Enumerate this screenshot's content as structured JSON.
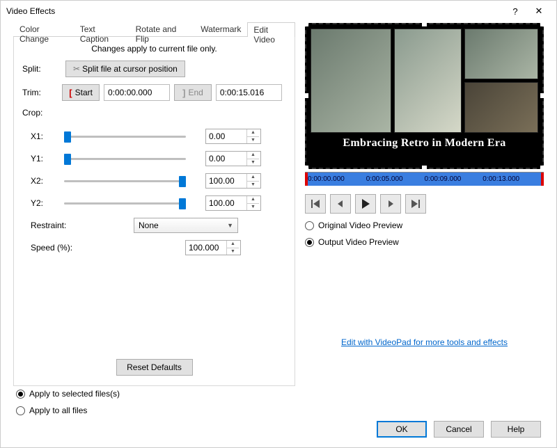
{
  "title": "Video Effects",
  "tabs": [
    "Color Change",
    "Text Caption",
    "Rotate and Flip",
    "Watermark",
    "Edit Video"
  ],
  "activeTab": 4,
  "note": "Changes apply to current file only.",
  "labels": {
    "split": "Split:",
    "split_btn": "Split file at cursor position",
    "trim": "Trim:",
    "start": "Start",
    "end": "End",
    "crop": "Crop:",
    "x1": "X1:",
    "y1": "Y1:",
    "x2": "X2:",
    "y2": "Y2:",
    "restraint": "Restraint:",
    "speed": "Speed (%):",
    "reset": "Reset Defaults"
  },
  "trim": {
    "start_time": "0:00:00.000",
    "end_time": "0:00:15.016"
  },
  "crop": {
    "x1": "0.00",
    "y1": "0.00",
    "x2": "100.00",
    "y2": "100.00"
  },
  "restraint_value": "None",
  "speed_value": "100.000",
  "preview": {
    "caption": "Embracing Retro in Modern Era",
    "ticks": [
      "0:00:00.000",
      "0:00:05.000",
      "0:00:09.000",
      "0:00:13.000"
    ]
  },
  "preview_mode": {
    "original": "Original Video Preview",
    "output": "Output Video Preview"
  },
  "link_text": "Edit with VideoPad for more tools and effects",
  "apply": {
    "selected": "Apply to selected files(s)",
    "all": "Apply to all files"
  },
  "footer": {
    "ok": "OK",
    "cancel": "Cancel",
    "help": "Help"
  }
}
